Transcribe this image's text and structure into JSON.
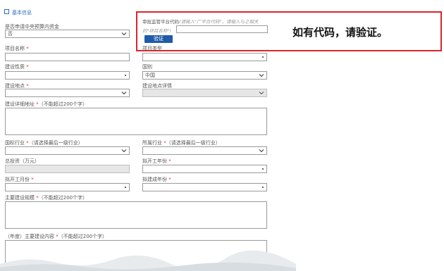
{
  "section": {
    "title": "基本信息"
  },
  "callout": {
    "text": "如有代码，请验证。"
  },
  "code_panel": {
    "label": "审批监管平台代码",
    "hint_line1": "(请输入\"广平台代码\"，请输入与之相关",
    "hint_line2": "的\"项目名称\")",
    "verify_label": "验证"
  },
  "left": {
    "central_budget": {
      "label": "是否申请中央预算内资金",
      "value": "否"
    },
    "project_name": {
      "label": "项目名称"
    },
    "construction_nature": {
      "label": "建设性质"
    },
    "construction_location": {
      "label": "建设地点"
    },
    "detail_address": {
      "label": "建设详细地址",
      "note": "（不能超过200个字）"
    },
    "national_industry": {
      "label": "国标行业",
      "note": "（请选择最后一级行业）"
    },
    "total_investment": {
      "label": "总投资（万元）"
    },
    "start_month": {
      "label": "拟开工月份"
    },
    "main_scale": {
      "label": "主要建设规模",
      "note": "（不能超过200个字）"
    },
    "annual_content": {
      "prefix": "（年度）",
      "label": "主要建设内容",
      "note": "（不能超过200个字）"
    }
  },
  "right": {
    "project_type": {
      "label": "项目类型"
    },
    "country": {
      "label": "国别",
      "value": "中国"
    },
    "location_detail": {
      "label": "建设地点详情"
    },
    "industry": {
      "label": "所属行业",
      "note": "（请选择最后一级行业）"
    },
    "start_year": {
      "label": "拟开工年份"
    },
    "completion_year": {
      "label": "拟建成年份"
    }
  }
}
